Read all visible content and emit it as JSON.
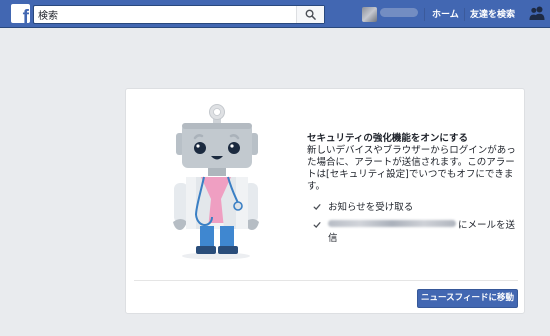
{
  "topbar": {
    "logo_letter": "f",
    "search": {
      "value": "検索",
      "placeholder": "検索"
    },
    "nav": {
      "home_label": "ホーム",
      "friends_label": "友達を検索"
    }
  },
  "card": {
    "title": "セキュリティの強化機能をオンにする",
    "description": "新しいデバイスやブラウザーからログインがあった場合に、アラートが送信されます。このアラートは[セキュリティ設定]でいつでもオフにできます。",
    "options": [
      {
        "label": "お知らせを受け取る",
        "checked": true
      },
      {
        "label_suffix": "にメールを送信",
        "checked": true
      }
    ],
    "primary_button": "ニュースフィードに移動"
  },
  "colors": {
    "brand": "#4267b2",
    "page_background": "#e9ebee",
    "card_border": "#dddfe2"
  }
}
